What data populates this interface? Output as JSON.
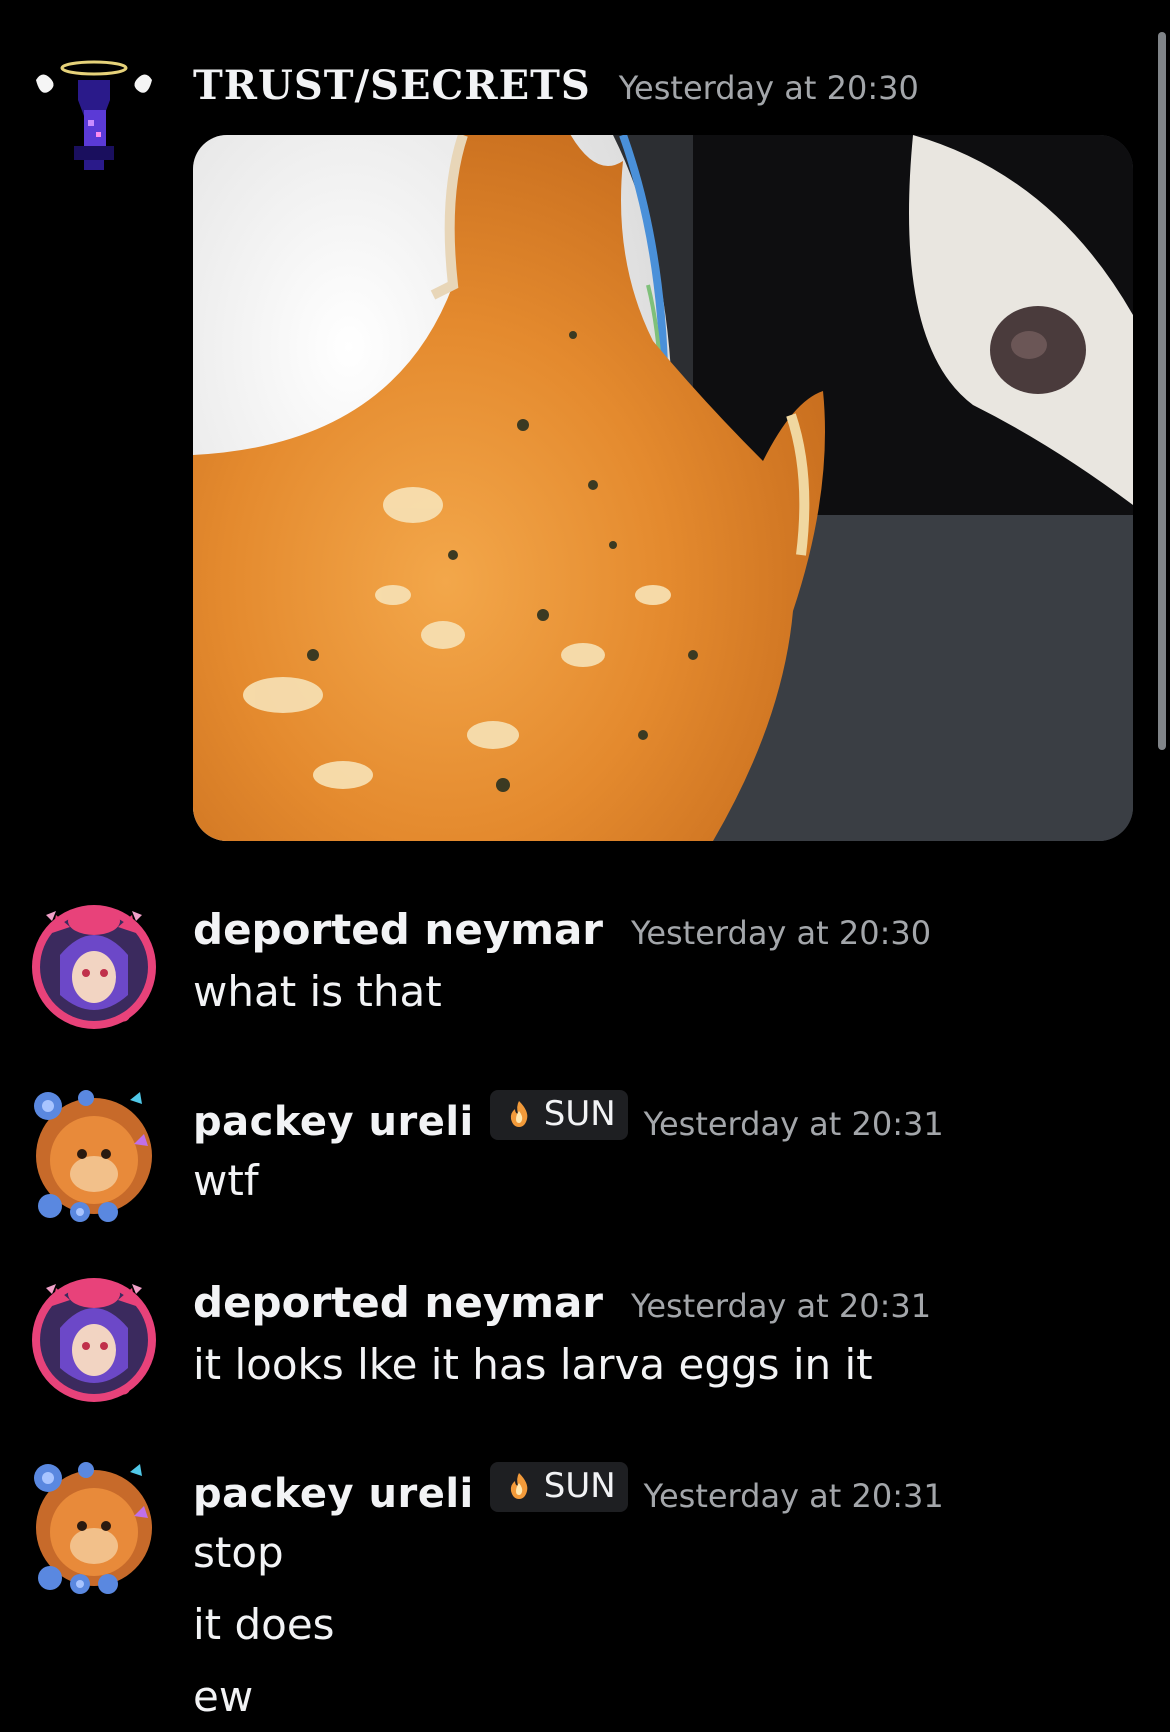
{
  "messages": [
    {
      "author": "TRUST/SECRETS",
      "timestamp": "Yesterday at 20:30",
      "attachment": "photo"
    },
    {
      "author": "deported neymar",
      "timestamp": "Yesterday at 20:30",
      "lines": [
        "what is that"
      ]
    },
    {
      "author": "packey ureli",
      "tag": "SUN",
      "timestamp": "Yesterday at 20:31",
      "lines": [
        "wtf"
      ]
    },
    {
      "author": "deported neymar",
      "timestamp": "Yesterday at 20:31",
      "lines": [
        "it looks lke it has larva eggs in it"
      ]
    },
    {
      "author": "packey ureli",
      "tag": "SUN",
      "timestamp": "Yesterday at 20:31",
      "lines": [
        "stop",
        "it does",
        "ew"
      ]
    }
  ],
  "colors": {
    "background": "#000000",
    "text": "#f2f3f5",
    "timestamp": "#a3a6aa",
    "tag_bg": "#1e1f22"
  },
  "icons": {
    "tag_icon": "flame-icon",
    "avatar_1": "angel-figure-avatar",
    "avatar_2": "demon-girl-avatar",
    "avatar_3": "flower-monkey-avatar"
  }
}
